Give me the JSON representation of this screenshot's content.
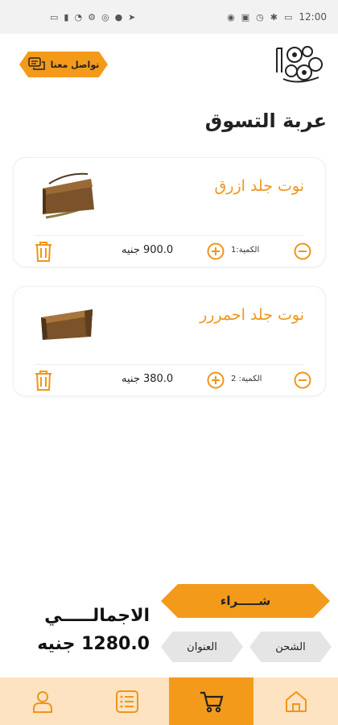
{
  "status_bar": {
    "time": "12:00",
    "left_icons": [
      "sim-icon",
      "signal-icon",
      "wifi-icon",
      "settings-icon",
      "instagram-icon",
      "facebook-icon",
      "send-icon"
    ],
    "right_icons": [
      "eye-icon",
      "nfc-icon",
      "alarm-icon",
      "bluetooth-icon",
      "battery-icon"
    ]
  },
  "header": {
    "contact_label": "تواصل معنا",
    "title": "عربة التسوق"
  },
  "cart_items": [
    {
      "name": "نوت جلد ازرق",
      "price": "900.0 جنيه",
      "quantity": "الكمية:1"
    },
    {
      "name": "نوت جلد احمررر",
      "price": "380.0 جنيه",
      "quantity": "الكمية: 2"
    }
  ],
  "footer": {
    "buy_label": "شـــــراء",
    "shipping_label": "الشحن",
    "address_label": "العنوان",
    "total_label": "الاجمالـــــي",
    "total_value": "1280.0 جنيه"
  },
  "nav": {
    "items": [
      "profile-icon",
      "orders-icon",
      "cart-icon",
      "home-icon"
    ],
    "active": "cart-icon"
  },
  "colors": {
    "accent": "#f39a1b",
    "nav_bg": "#fde3c1",
    "pill_gray": "#e5e5e5"
  }
}
